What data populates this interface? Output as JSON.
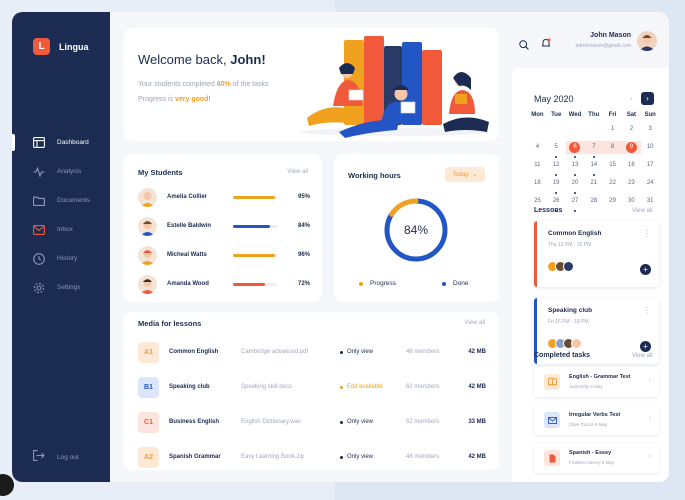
{
  "brand": {
    "name": "Lingua",
    "mark": "L"
  },
  "sidebar": {
    "items": [
      {
        "label": "Dashboard",
        "icon": "dashboard-icon",
        "active": true
      },
      {
        "label": "Analysis",
        "icon": "analysis-icon"
      },
      {
        "label": "Documents",
        "icon": "folder-icon"
      },
      {
        "label": "Inbox",
        "icon": "inbox-icon"
      },
      {
        "label": "History",
        "icon": "clock-icon"
      },
      {
        "label": "Settings",
        "icon": "gear-icon"
      }
    ],
    "logout": "Log out"
  },
  "welcome": {
    "greeting": "Welcome back,",
    "name": "John!",
    "line1_prefix": "Your students completed",
    "line1_value": "80%",
    "line1_suffix": "of the tasks",
    "line2_prefix": "Progress is",
    "line2_value": "very good!"
  },
  "students": {
    "title": "My Students",
    "view_all": "View all",
    "rows": [
      {
        "name": "Amelia Collier",
        "pct": "95%",
        "progress": 0.95,
        "color": "#f0a21e"
      },
      {
        "name": "Estelle Baldwin",
        "pct": "84%",
        "progress": 0.84,
        "color": "#2256c4"
      },
      {
        "name": "Micheal Watts",
        "pct": "96%",
        "progress": 0.96,
        "color": "#f0a21e"
      },
      {
        "name": "Amanda Wood",
        "pct": "72%",
        "progress": 0.72,
        "color": "#f05a3a"
      }
    ]
  },
  "hours": {
    "title": "Working hours",
    "filter": "Today",
    "value": "84%",
    "progress_fraction": 0.16,
    "done_fraction": 0.84,
    "legend_progress": "Progress",
    "legend_done": "Done",
    "colors": {
      "progress": "#f0a21e",
      "done": "#2256c4"
    }
  },
  "media": {
    "title": "Media for lessons",
    "view_all": "View all",
    "rows": [
      {
        "level": "A1",
        "name": "Common English",
        "file": "Cambridge advanced.pdf",
        "access": "Only view",
        "members": "46 members",
        "size": "42 MB",
        "tag_bg": "#fde9d6",
        "tag_fg": "#f09a3a"
      },
      {
        "level": "B1",
        "name": "Speaking club",
        "file": "Speaking skill.docs",
        "access": "Edit available",
        "members": "62 members",
        "size": "42 MB",
        "tag_bg": "#dbe6fb",
        "tag_fg": "#2256c4"
      },
      {
        "level": "C1",
        "name": "Business English",
        "file": "English Dictionary.wav",
        "access": "Only view",
        "members": "52 members",
        "size": "33 MB",
        "tag_bg": "#fde4de",
        "tag_fg": "#f05a3a"
      },
      {
        "level": "A2",
        "name": "Spanish Grammar",
        "file": "Easy Learning Book.zip",
        "access": "Only view",
        "members": "48 members",
        "size": "42 MB",
        "tag_bg": "#fde9d6",
        "tag_fg": "#f09a3a"
      }
    ]
  },
  "user": {
    "name": "John Mason",
    "email": "edmbmason@gmail.com"
  },
  "calendar": {
    "title": "May 2020",
    "days": [
      "Mon",
      "Tue",
      "Wed",
      "Thu",
      "Fri",
      "Sat",
      "Sun"
    ],
    "weeks": [
      [
        "",
        "",
        "",
        "",
        "1",
        "2",
        "3"
      ],
      [
        "4",
        "5",
        "6",
        "7",
        "8",
        "9",
        "10"
      ],
      [
        "11",
        "12",
        "13",
        "14",
        "15",
        "16",
        "17"
      ],
      [
        "18",
        "19",
        "20",
        "21",
        "22",
        "23",
        "24"
      ],
      [
        "25",
        "26",
        "27",
        "28",
        "29",
        "30",
        "31"
      ]
    ]
  },
  "lessons": {
    "title": "Lessons",
    "view_all": "View all",
    "items": [
      {
        "name": "Common English",
        "time": "Thu 13 PM - 15 PM",
        "color": "#f05a3a"
      },
      {
        "name": "Speaking club",
        "time": "Fri 16 PM - 18 PM",
        "color": "#2256c4"
      }
    ]
  },
  "tasks": {
    "title": "Completed tasks",
    "view_all": "View all",
    "items": [
      {
        "name": "English - Grammar Test",
        "sub": "Sula Kelly  6 May",
        "icon": "book-icon",
        "bg": "#fde9d6",
        "fg": "#f09a3a"
      },
      {
        "name": "Irregular Verbs Test",
        "sub": "Olive Garcia  6 May",
        "icon": "mail-icon",
        "bg": "#dbe6fb",
        "fg": "#2256c4"
      },
      {
        "name": "Spanish - Essey",
        "sub": "Franklin Harvey  2 May",
        "icon": "document-icon",
        "bg": "#fde4de",
        "fg": "#f05a3a"
      }
    ]
  }
}
